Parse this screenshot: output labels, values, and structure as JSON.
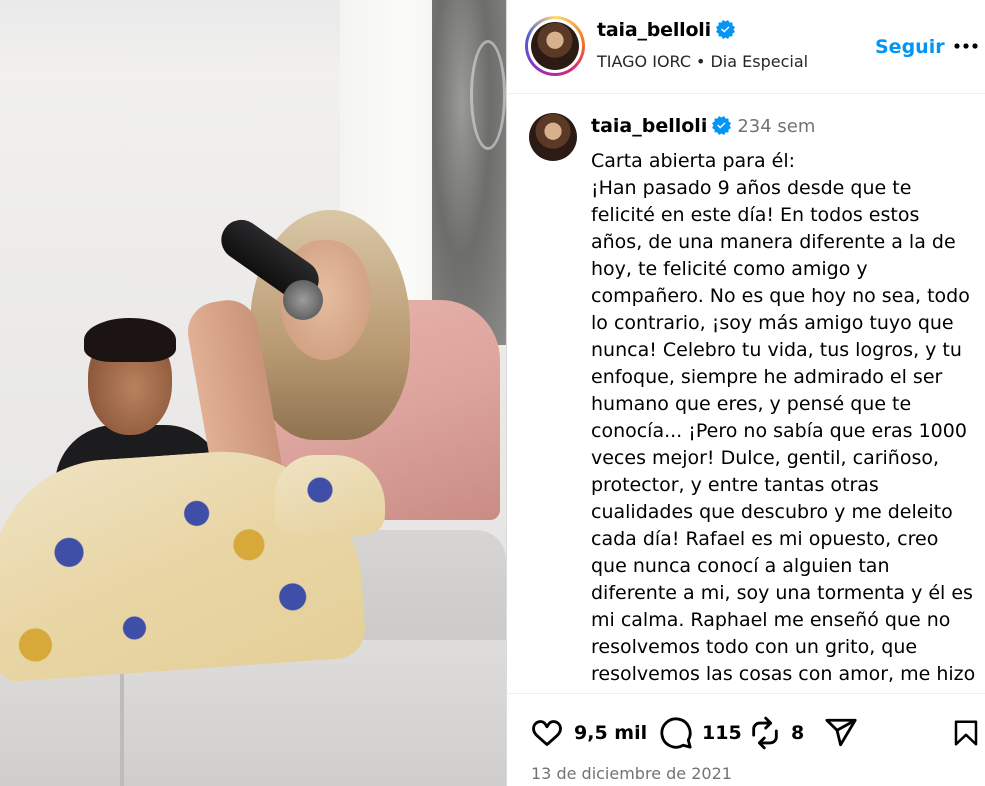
{
  "post": {
    "username": "taia_belloli",
    "verified": true,
    "audio_artist": "TIAGO IORC",
    "audio_separator": "•",
    "audio_track": "Dia Especial",
    "follow_label": "Seguir",
    "more_icon": "more-horizontal-icon"
  },
  "caption": {
    "username": "taia_belloli",
    "age": "234 sem",
    "text": "Carta abierta para él:\n¡Han pasado 9 años desde que te felicité en este día! En todos estos años, de una manera diferente a la de hoy, te felicité como amigo y compañero. No es que hoy no sea, todo lo contrario, ¡soy más amigo tuyo que nunca! Celebro tu vida, tus logros, y tu enfoque, siempre he admirado el ser humano que eres, y pensé que te conocía... ¡Pero no sabía que eras 1000 veces mejor! Dulce, gentil, cariñoso, protector, y entre tantas otras cualidades que descubro y me deleito cada día! Rafael es mi opuesto, creo que nunca conocí a alguien tan diferente a mi, soy una tormenta y él es mi calma. Raphael me enseñó que no resolvemos todo con un grito, que resolvemos las cosas con amor, me hizo cambiar del agua al vino, o me hizo"
  },
  "actions": {
    "likes": "9,5 mil",
    "comments": "115",
    "reposts": "8",
    "icons": [
      "heart-icon",
      "comment-icon",
      "repost-icon",
      "share-icon",
      "bookmark-icon"
    ]
  },
  "date": "13 de diciembre de 2021",
  "colors": {
    "accent": "#0095f6",
    "verified": "#0095f6",
    "muted": "#737373"
  }
}
